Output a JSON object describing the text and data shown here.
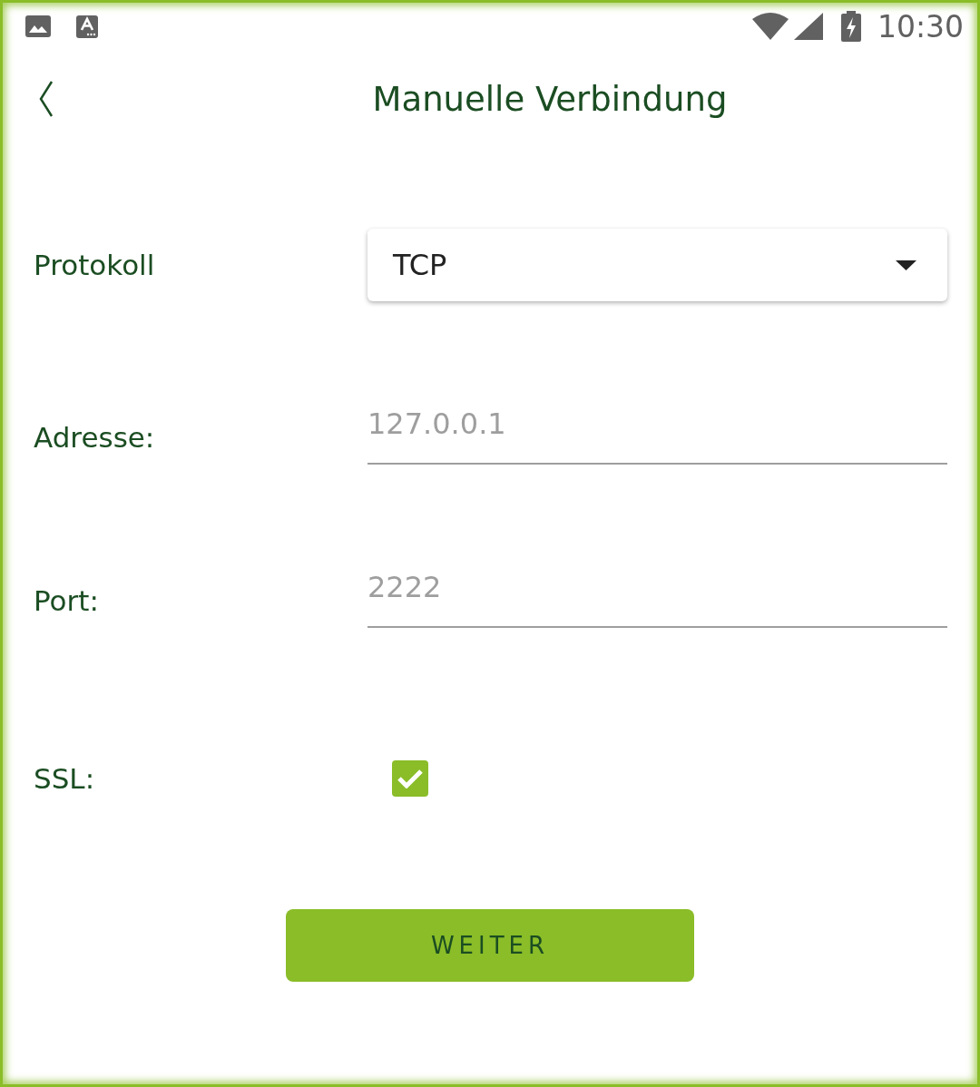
{
  "status_bar": {
    "time": "10:30"
  },
  "header": {
    "title": "Manuelle Verbindung"
  },
  "form": {
    "rows": [
      {
        "kind": "dropdown",
        "label": "Protokoll",
        "value": "TCP"
      },
      {
        "kind": "text",
        "label": "Adresse:",
        "placeholder": "127.0.0.1"
      },
      {
        "kind": "text",
        "label": "Port:",
        "placeholder": "2222"
      },
      {
        "kind": "checkbox",
        "label": "SSL:",
        "checked": true
      }
    ]
  },
  "button": {
    "label": "WEITER"
  }
}
